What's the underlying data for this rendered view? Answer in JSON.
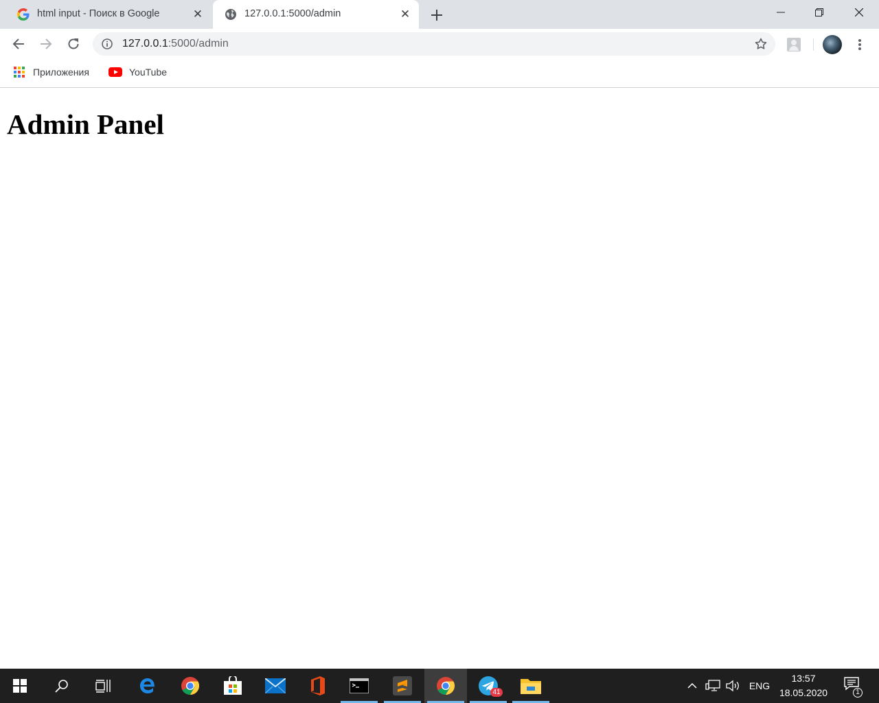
{
  "browser": {
    "tabs": [
      {
        "title": "html input - Поиск в Google",
        "icon": "google-g-icon",
        "active": false
      },
      {
        "title": "127.0.0.1:5000/admin",
        "icon": "globe-icon",
        "active": true
      }
    ],
    "address": {
      "host": "127.0.0.1",
      "rest": ":5000/admin"
    },
    "bookmarks": [
      {
        "label": "Приложения",
        "icon": "apps-grid-icon"
      },
      {
        "label": "YouTube",
        "icon": "youtube-icon"
      }
    ]
  },
  "page": {
    "heading": "Admin Panel"
  },
  "taskbar": {
    "apps": [
      {
        "name": "Microsoft Edge",
        "icon": "edge-icon"
      },
      {
        "name": "Google Chrome",
        "icon": "chrome-icon"
      },
      {
        "name": "Microsoft Store",
        "icon": "store-icon"
      },
      {
        "name": "Mail",
        "icon": "mail-icon"
      },
      {
        "name": "Office",
        "icon": "office-icon"
      },
      {
        "name": "Command Prompt",
        "icon": "cmd-icon"
      },
      {
        "name": "Sublime Text",
        "icon": "sublime-icon"
      },
      {
        "name": "Google Chrome",
        "icon": "chrome-icon"
      },
      {
        "name": "Telegram",
        "icon": "telegram-icon"
      },
      {
        "name": "File Explorer",
        "icon": "folder-icon"
      }
    ],
    "telegram_badge": "41",
    "language": "ENG",
    "time": "13:57",
    "date": "18.05.2020",
    "notification_count": "1"
  },
  "colors": {
    "tabstrip": "#dee1e6",
    "omnibox": "#f1f3f4",
    "taskbar": "#1f1f1f",
    "taskbar_running": "#76b9ed"
  }
}
